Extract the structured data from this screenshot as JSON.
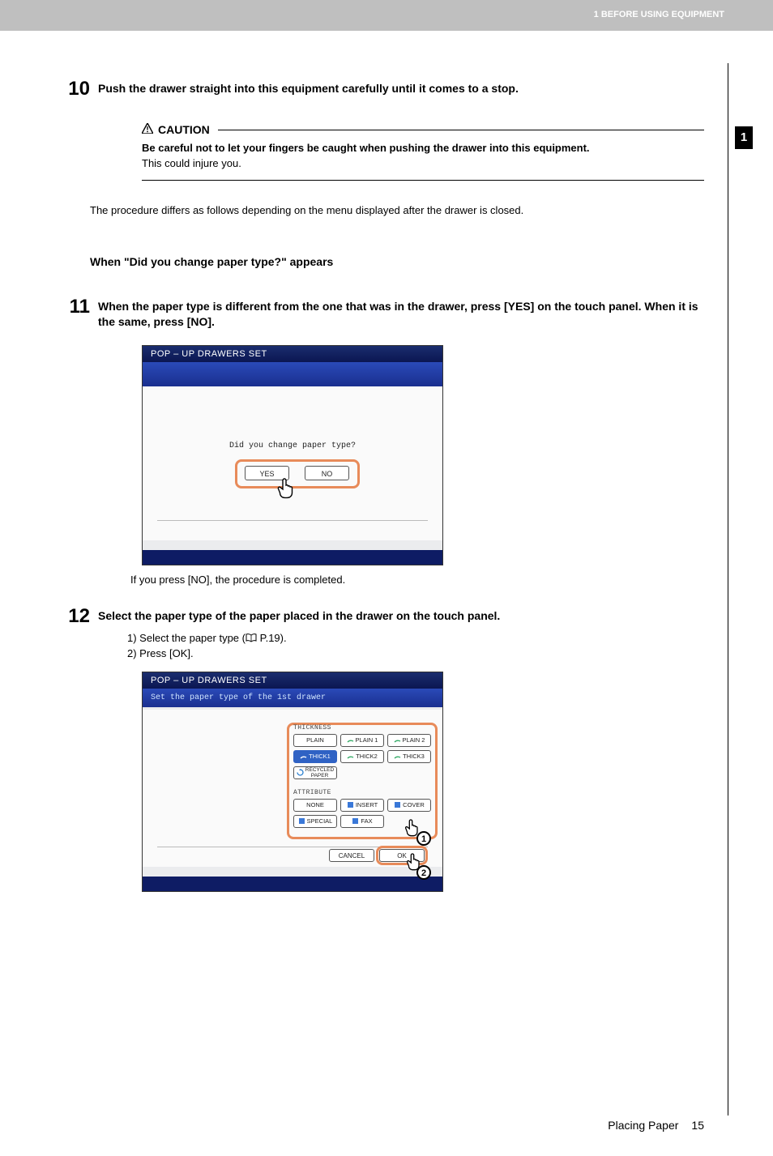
{
  "header": {
    "section_label": "1 BEFORE USING EQUIPMENT"
  },
  "side_tab": {
    "chapter_num": "1"
  },
  "steps": {
    "s10": {
      "num": "10",
      "text": "Push the drawer straight into this equipment carefully until it comes to a stop."
    },
    "caution": {
      "label": "CAUTION",
      "bold_line": "Be careful not to let your fingers be caught when pushing the drawer into this equipment.",
      "line2": "This could injure you."
    },
    "intro_para": "The procedure differs as follows depending on the menu displayed after the drawer is closed.",
    "subhead": "When \"Did you change paper type?\" appears",
    "s11": {
      "num": "11",
      "text": "When the paper type is different from the one that was in the drawer, press [YES] on the touch panel. When it is the same, press [NO]."
    },
    "screen1": {
      "title": "POP – UP DRAWERS  SET",
      "question": "Did you change paper type?",
      "yes": "YES",
      "no": "NO"
    },
    "after_no": "If you press [NO], the procedure is completed.",
    "s12": {
      "num": "12",
      "text": "Select the paper type of the paper placed in the drawer on the touch panel.",
      "sub1_prefix": "1)  Select the paper type (",
      "sub1_ref": " P.19).",
      "sub2": "2)  Press [OK]."
    },
    "screen2": {
      "title": "POP – UP DRAWERS  SET",
      "subtitle": "Set the paper type of the 1st drawer",
      "thickness_label": "THICKNESS",
      "attribute_label": "ATTRIBUTE",
      "opts": {
        "plain": "PLAIN",
        "plain1": "PLAIN 1",
        "plain2": "PLAIN 2",
        "thick1": "THICK1",
        "thick2": "THICK2",
        "thick3": "THICK3",
        "recycled_l1": "RECYCLED",
        "recycled_l2": "PAPER",
        "none": "NONE",
        "insert": "INSERT",
        "cover": "COVER",
        "special": "SPECIAL",
        "fax": "FAX"
      },
      "cancel": "CANCEL",
      "ok": "OK",
      "badge1": "1",
      "badge2": "2"
    }
  },
  "footer": {
    "title": "Placing Paper",
    "page": "15"
  }
}
